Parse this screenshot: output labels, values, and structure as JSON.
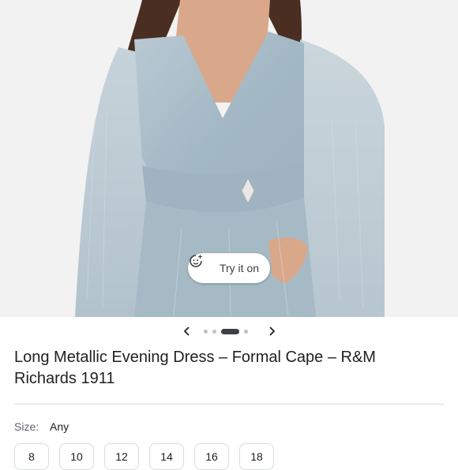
{
  "product": {
    "title": "Long Metallic Evening Dress – Formal Cape – R&M Richards 1911",
    "image_icon": "dress-photo",
    "try_on": {
      "label": "Try it on",
      "icon": "sparkle-face-icon"
    }
  },
  "carousel": {
    "prev_icon": "chevron-left-icon",
    "next_icon": "chevron-right-icon",
    "dot_count": 4,
    "active_index": 2
  },
  "size": {
    "label": "Size:",
    "value": "Any",
    "options": [
      "8",
      "10",
      "12",
      "14",
      "16",
      "18"
    ]
  },
  "colors": {
    "background": "#f2f2f2",
    "dress": "#a9bcc8",
    "hair": "#4a2e22",
    "skin": "#d9a88a",
    "accent_dark": "#3c4043"
  }
}
